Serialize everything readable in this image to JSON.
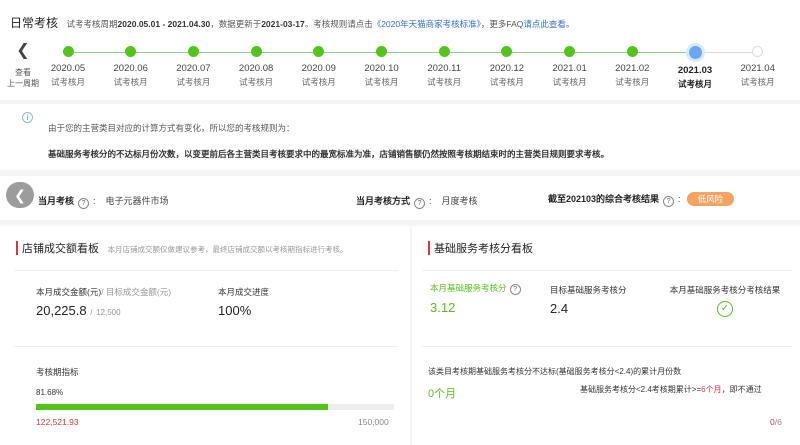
{
  "header": {
    "title": "日常考核",
    "cycle_prefix": "试考考核周期",
    "cycle_range": "2020.05.01 - 2021.04.30",
    "updated_prefix": "，数据更新于",
    "updated_date": "2021-03-17",
    "rule_prefix": "。考核规则请点击",
    "rule_link": "《2020年天猫商家考核标准》",
    "faq_prefix": "，更多FAQ",
    "faq_link": "请点此查看",
    "faq_suffix": "。"
  },
  "nav": {
    "back_label_line1": "查看",
    "back_label_line2": "上一周期"
  },
  "timeline": {
    "current_index": 11,
    "nodes": [
      {
        "month": "2020.05",
        "label": "试考核月",
        "state": "done"
      },
      {
        "month": "2020.06",
        "label": "试考核月",
        "state": "done"
      },
      {
        "month": "2020.07",
        "label": "试考核月",
        "state": "done"
      },
      {
        "month": "2020.08",
        "label": "试考核月",
        "state": "done"
      },
      {
        "month": "2020.09",
        "label": "试考核月",
        "state": "done"
      },
      {
        "month": "2020.10",
        "label": "试考核月",
        "state": "done"
      },
      {
        "month": "2020.11",
        "label": "试考核月",
        "state": "done"
      },
      {
        "month": "2020.12",
        "label": "试考核月",
        "state": "done"
      },
      {
        "month": "2021.01",
        "label": "试考核月",
        "state": "done"
      },
      {
        "month": "2021.02",
        "label": "试考核月",
        "state": "done"
      },
      {
        "month": "2021.03",
        "label": "试考核月",
        "state": "current"
      },
      {
        "month": "2021.04",
        "label": "试考核月",
        "state": "future"
      }
    ]
  },
  "notice": {
    "line1": "由于您的主营类目对应的计算方式有变化，所以您的考核规则为：",
    "line2": "基础服务考核分的不达标月份次数，以变更前后各主营类目考核要求中的最宽标准为准，店铺销售额仍然按照考核期结束时的主营类目规则要求考核。"
  },
  "assessment": {
    "month_label": "当月考核",
    "month_value": "电子元器件市场",
    "method_label": "当月考核方式",
    "method_value": "月度考核",
    "result_label": "截至202103的综合考核结果",
    "result_badge": "低风险"
  },
  "sales_board": {
    "title": "店铺成交额看板",
    "desc": "本月店铺成交额仅做建议参考，最终店铺成交额以考核期指标进行考核。",
    "amount_label": "本月成交金额(元)",
    "target_label": "/ 目标成交金额(元)",
    "amount_value": "20,225.8",
    "target_value": "12,500",
    "progress_label": "本月成交进度",
    "progress_value": "100%",
    "period_label": "考核期指标",
    "period_percent": "81.68%",
    "period_fraction": 0.8168,
    "period_current": "122,521.93",
    "period_target": "150,000"
  },
  "service_board": {
    "title": "基础服务考核分看板",
    "score_label": "本月基础服务考核分",
    "score_value": "3.12",
    "target_label": "目标基础服务考核分",
    "target_value": "2.4",
    "result_label": "本月基础服务考核分考核结果",
    "months_desc": "该类目考核期基础服务考核分不达标(基础服务考核分<2.4)的累计月份数",
    "months_value": "0个月",
    "rule_text": "基础服务考核分<2.4考核期累计>=",
    "rule_count": "6个月",
    "rule_tail": "，即不通过",
    "count_current": "0",
    "count_total": "/6"
  },
  "colors": {
    "green": "#52c41a",
    "red": "#d9363e",
    "blue": "#2f6fd8",
    "badge": "#f5a263"
  }
}
